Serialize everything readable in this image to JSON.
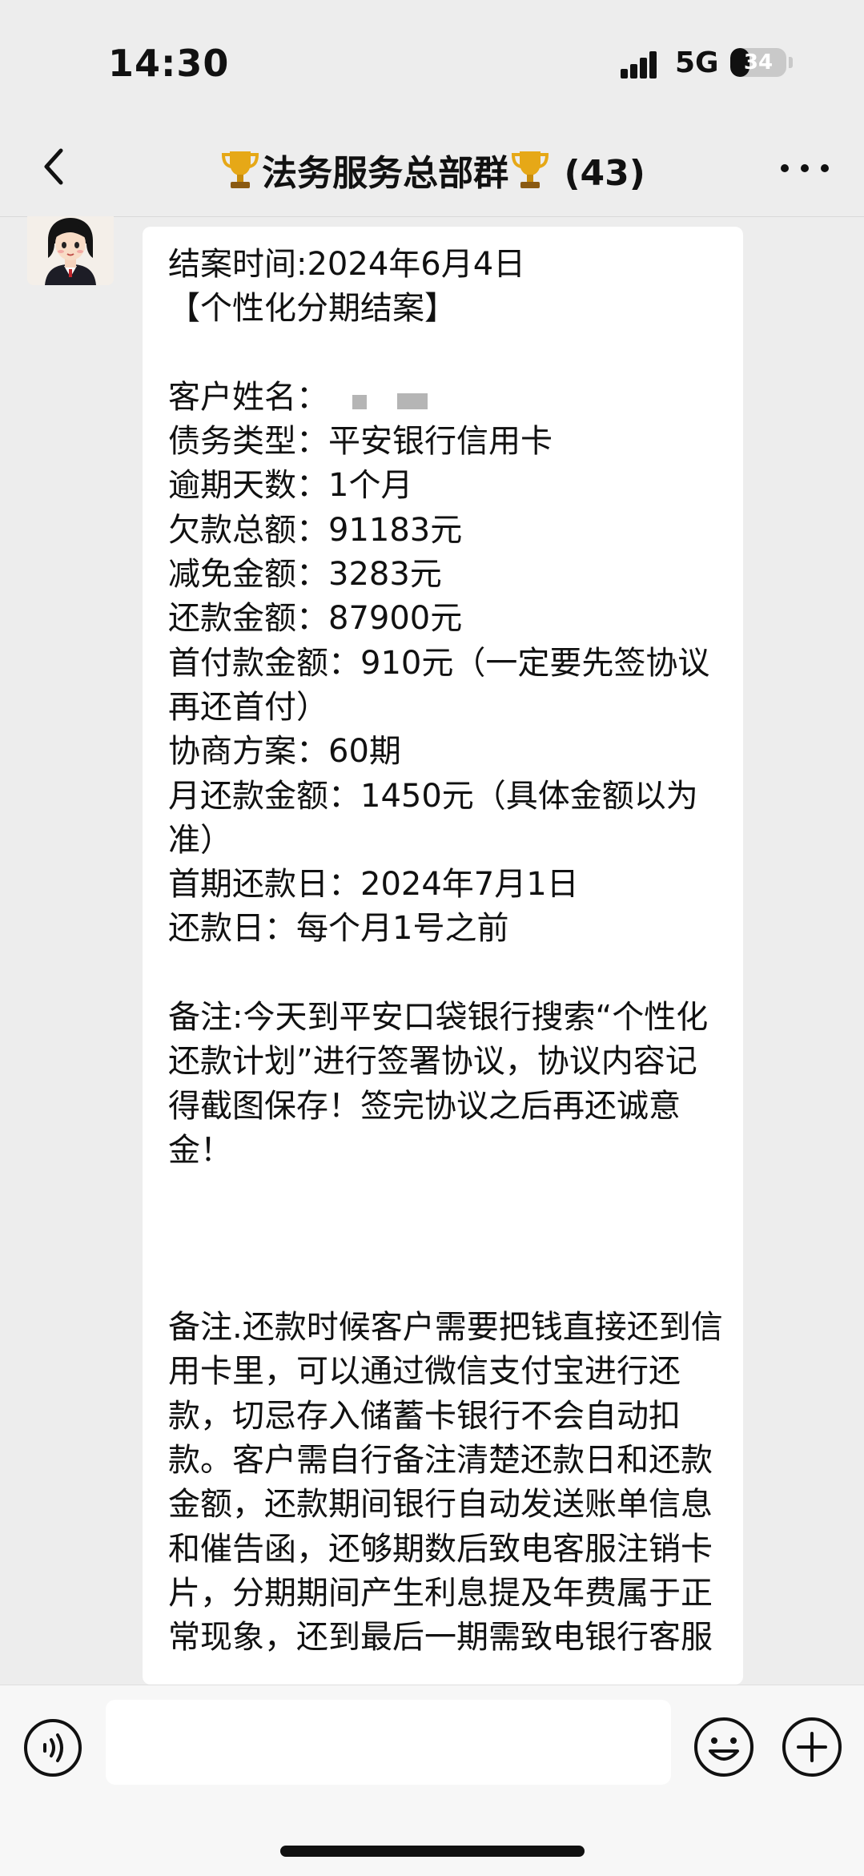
{
  "status_bar": {
    "time": "14:30",
    "network": "5G",
    "battery_level": "34",
    "battery_fraction": 0.34
  },
  "nav": {
    "back_icon": "chevron-left-icon",
    "trophy_icon": "trophy-icon",
    "title": "法务服务总部群",
    "member_count": "(43)",
    "more_icon": "more-dots-icon"
  },
  "message": {
    "sender_avatar": "avatar-cartoon-lawyer",
    "text": "结案时间:2024年6月4日\n【个性化分期结案】\n\n客户姓名：\n债务类型：平安银行信用卡\n逾期天数：1个月\n欠款总额：91183元\n减免金额：3283元\n还款金额：87900元\n首付款金额：910元（一定要先签协议再还首付）\n协商方案：60期\n月还款金额：1450元（具体金额以为准）\n首期还款日：2024年7月1日\n还款日：每个月1号之前\n\n备注:今天到平安口袋银行搜索“个性化还款计划”进行签署协议，协议内容记得截图保存！签完协议之后再还诚意金！\n\n\n\n备注.还款时候客户需要把钱直接还到信用卡里，可以通过微信支付宝进行还款，切忌存入储蓄卡银行不会自动扣款。客户需自行备注清楚还款日和还款金额，还款期间银行自动发送账单信息和催告函，还够期数后致电客服注销卡片，分期期间产生利息提及年费属于正常现象，还到最后一期需致电银行客服"
  },
  "input_bar": {
    "voice_icon": "voice-icon",
    "input_value": "",
    "emoji_icon": "emoji-icon",
    "plus_icon": "plus-icon"
  },
  "colors": {
    "background": "#ededed",
    "bubble": "#ffffff",
    "text": "#111111",
    "trophy_gold": "#e6a817"
  }
}
